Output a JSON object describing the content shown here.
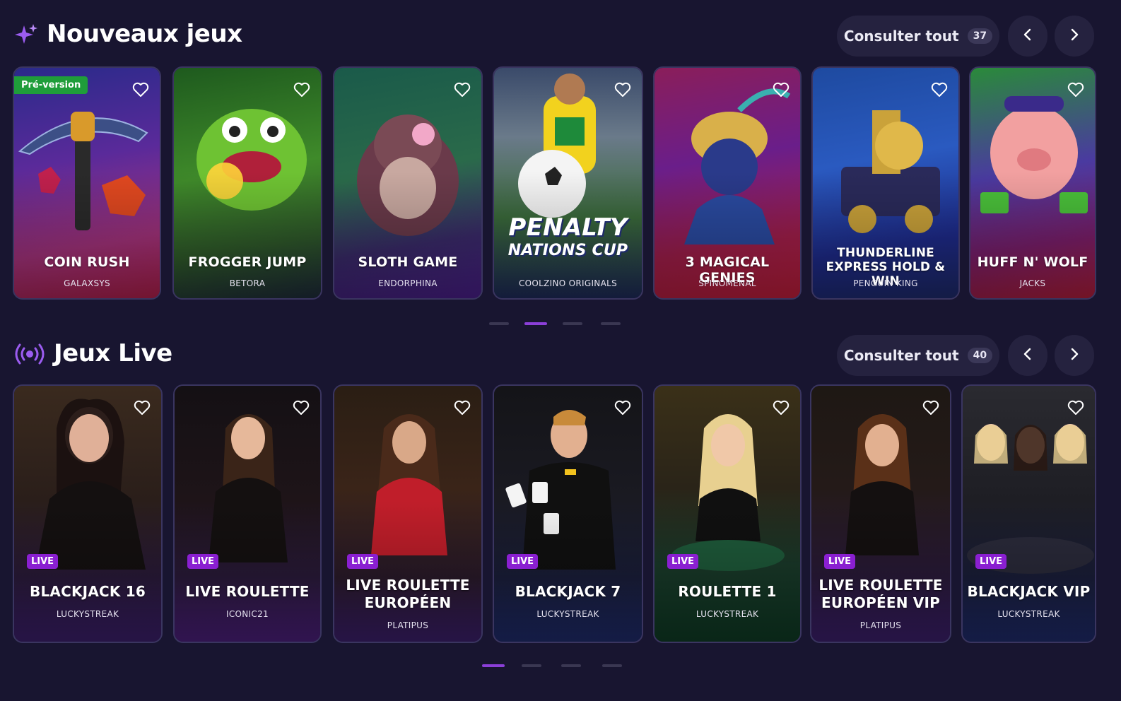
{
  "new_games": {
    "title": "Nouveaux jeux",
    "view_all_label": "Consulter tout",
    "view_all_count": "37",
    "icon": "sparkle-icon",
    "cards": [
      {
        "title": "Coin Rush",
        "provider": "GALAXSYS",
        "badge": "Pré-version"
      },
      {
        "title": "Frogger Jump",
        "provider": "BETORA"
      },
      {
        "title": "Sloth Game",
        "provider": "ENDORPHINA"
      },
      {
        "title": "",
        "provider": "COOLZINO ORIGINALS",
        "logo_line1": "PENALTY",
        "logo_line2": "NATIONS CUP"
      },
      {
        "title": "3 Magical Genies",
        "provider": "SPINOMENAL"
      },
      {
        "title": "Thunderline Express Hold & Win",
        "provider": "PENGUIN KING"
      },
      {
        "title": "Huff N' Wolf",
        "provider": "JACKS"
      }
    ],
    "pager": {
      "pages": 4,
      "active": 2
    }
  },
  "live_games": {
    "title": "Jeux Live",
    "view_all_label": "Consulter tout",
    "view_all_count": "40",
    "icon": "broadcast-icon",
    "badge_label": "LIVE",
    "cards": [
      {
        "title": "Blackjack 16",
        "provider": "LUCKYSTREAK"
      },
      {
        "title": "Live Roulette",
        "provider": "ICONIC21"
      },
      {
        "title": "Live Roulette Européen",
        "provider": "PLATIPUS"
      },
      {
        "title": "Blackjack 7",
        "provider": "LUCKYSTREAK"
      },
      {
        "title": "Roulette 1",
        "provider": "LUCKYSTREAK"
      },
      {
        "title": "Live Roulette Européen VIP",
        "provider": "PLATIPUS"
      },
      {
        "title": "Blackjack VIP",
        "provider": "LUCKYSTREAK"
      }
    ],
    "pager": {
      "pages": 4,
      "active": 1
    }
  },
  "colors": {
    "background": "#181530",
    "accent": "#8b3fd8",
    "live_badge": "#8a1fd1",
    "prerelease_badge": "#1f9d3a"
  }
}
